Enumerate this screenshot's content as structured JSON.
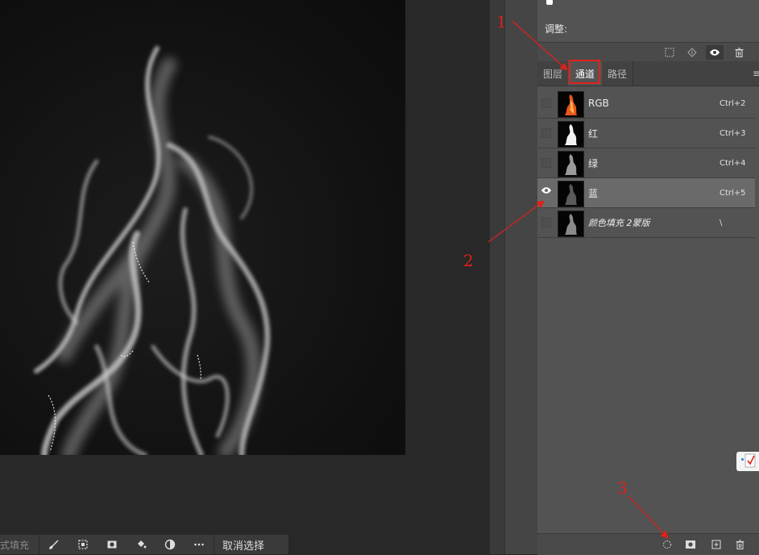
{
  "canvas": {
    "context_bar": {
      "fill_label": "式填充",
      "deselect_label": "取消选择",
      "icons": [
        "brush-icon",
        "transform-icon",
        "mask-icon",
        "bucket-icon",
        "adjust-icon",
        "more-icon"
      ]
    }
  },
  "panel": {
    "adjustments_label": "调整:",
    "tabs": [
      {
        "label": "图层"
      },
      {
        "label": "通道"
      },
      {
        "label": "路径"
      }
    ],
    "channels": [
      {
        "name": "RGB",
        "shortcut": "Ctrl+2",
        "visible": false,
        "thumb": "color"
      },
      {
        "name": "红",
        "shortcut": "Ctrl+3",
        "visible": false,
        "thumb": "white"
      },
      {
        "name": "绿",
        "shortcut": "Ctrl+4",
        "visible": false,
        "thumb": "gray"
      },
      {
        "name": "蓝",
        "shortcut": "Ctrl+5",
        "visible": true,
        "thumb": "dark"
      },
      {
        "name": "颜色填充 2蒙版",
        "shortcut": "\\",
        "visible": false,
        "thumb": "gray"
      }
    ]
  },
  "annotations": [
    {
      "label": "1"
    },
    {
      "label": "2"
    },
    {
      "label": "3"
    }
  ],
  "colors": {
    "annotation": "#e0201a",
    "panel_bg": "#535353",
    "active_row": "#6a6a6a"
  }
}
